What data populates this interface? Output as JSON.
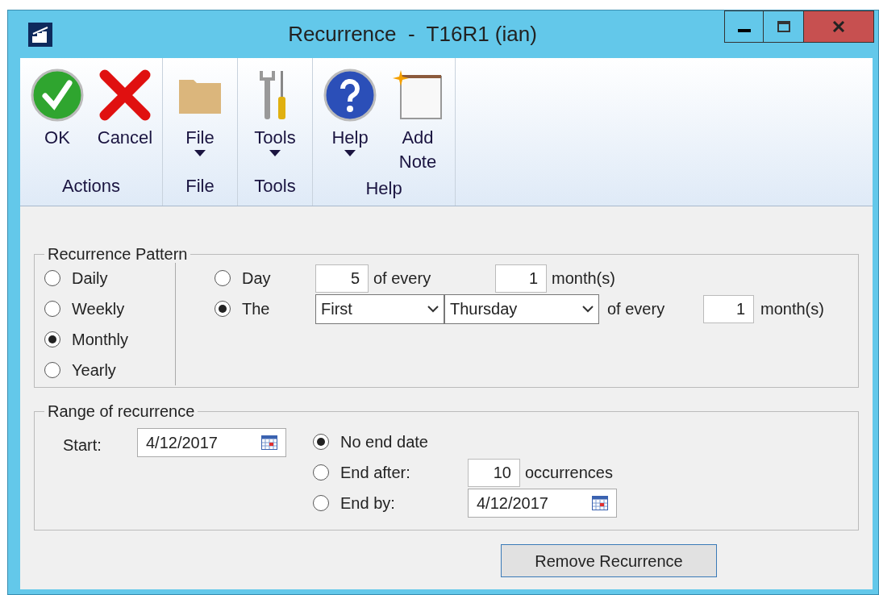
{
  "window": {
    "title": "Recurrence  -  T16R1 (ian)"
  },
  "ribbon": {
    "groups": [
      {
        "label": "Actions",
        "buttons": [
          {
            "label": "OK",
            "kind": "ok",
            "dropdown": false
          },
          {
            "label": "Cancel",
            "kind": "cancel",
            "dropdown": false
          }
        ]
      },
      {
        "label": "File",
        "buttons": [
          {
            "label": "File",
            "kind": "folder",
            "dropdown": true
          }
        ]
      },
      {
        "label": "Tools",
        "buttons": [
          {
            "label": "Tools",
            "kind": "tools",
            "dropdown": true
          }
        ]
      },
      {
        "label": "Help",
        "buttons": [
          {
            "label": "Help",
            "kind": "help",
            "dropdown": true
          },
          {
            "label": "Add Note",
            "kind": "note",
            "dropdown": false
          }
        ]
      }
    ]
  },
  "pattern": {
    "title": "Recurrence Pattern",
    "frequencies": [
      {
        "label": "Daily",
        "selected": false
      },
      {
        "label": "Weekly",
        "selected": false
      },
      {
        "label": "Monthly",
        "selected": true
      },
      {
        "label": "Yearly",
        "selected": false
      }
    ],
    "day_option": {
      "label": "Day",
      "selected": false,
      "day": "5",
      "of_every": "of every",
      "months": "1",
      "unit": "month(s)"
    },
    "the_option": {
      "label": "The",
      "selected": true,
      "ordinal": "First",
      "weekday": "Thursday",
      "of_every": "of every",
      "months": "1",
      "unit": "month(s)"
    }
  },
  "range": {
    "title": "Range of recurrence",
    "start_label": "Start:",
    "start_date": "4/12/2017",
    "end_options": [
      {
        "kind": "none",
        "label": "No end date",
        "selected": true
      },
      {
        "kind": "count",
        "label": "End after:",
        "selected": false,
        "value": "10",
        "unit": "occurrences"
      },
      {
        "kind": "date",
        "label": "End by:",
        "selected": false,
        "value": "4/12/2017"
      }
    ]
  },
  "button": "Remove Recurrence"
}
